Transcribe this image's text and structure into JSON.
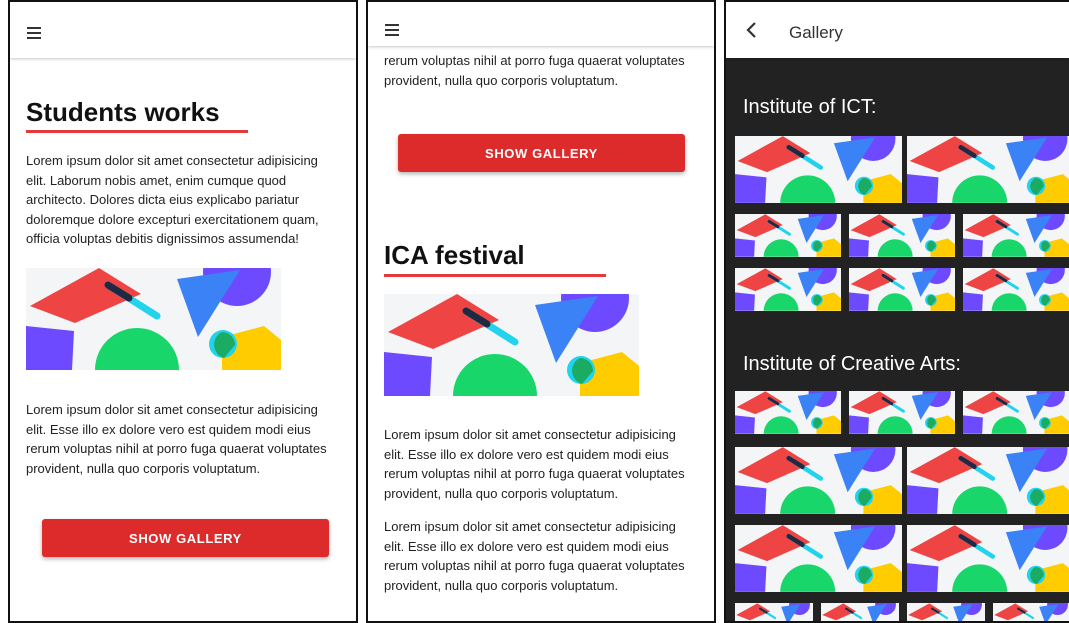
{
  "panel1": {
    "heading": "Students works",
    "para1": "Lorem ipsum dolor sit amet consectetur adipisicing elit. Laborum nobis amet, enim cumque quod architecto. Dolores dicta eius explicabo pariatur doloremque dolore excepturi exercitationem quam, officia voluptas debitis dignissimos assumenda!",
    "para2": "Lorem ipsum dolor sit amet consectetur adipisicing elit. Esse illo ex dolore vero est quidem modi eius rerum voluptas nihil at porro fuga quaerat voluptates provident, nulla quo corporis voluptatum.",
    "button": "SHOW GALLERY"
  },
  "panel2": {
    "para_top": "rerum voluptas nihil at porro fuga quaerat voluptates provident, nulla quo corporis voluptatum.",
    "button": "SHOW GALLERY",
    "heading": "ICA festival",
    "para1": "Lorem ipsum dolor sit amet consectetur adipisicing elit. Esse illo ex dolore vero est quidem modi eius rerum voluptas nihil at porro fuga quaerat voluptates provident, nulla quo corporis voluptatum.",
    "para2": "Lorem ipsum dolor sit amet consectetur adipisicing elit. Esse illo ex dolore vero est quidem modi eius rerum voluptas nihil at porro fuga quaerat voluptates provident, nulla quo corporis voluptatum."
  },
  "panel3": {
    "title": "Gallery",
    "section1": "Institute of ICT:",
    "section2": "Institute of Creative Arts:"
  },
  "icons": {
    "menu": "menu-icon",
    "back": "back-arrow-icon"
  },
  "colors": {
    "accent_red": "#dd2a2a",
    "underline_red": "#e03a3a",
    "gallery_background": "#222222",
    "shape_red": "#ef4444",
    "shape_blue": "#3b82f6",
    "shape_purple": "#6d4aff",
    "shape_green": "#19d66b",
    "shape_cyan": "#22d3ee",
    "shape_yellow": "#ffcc00"
  }
}
